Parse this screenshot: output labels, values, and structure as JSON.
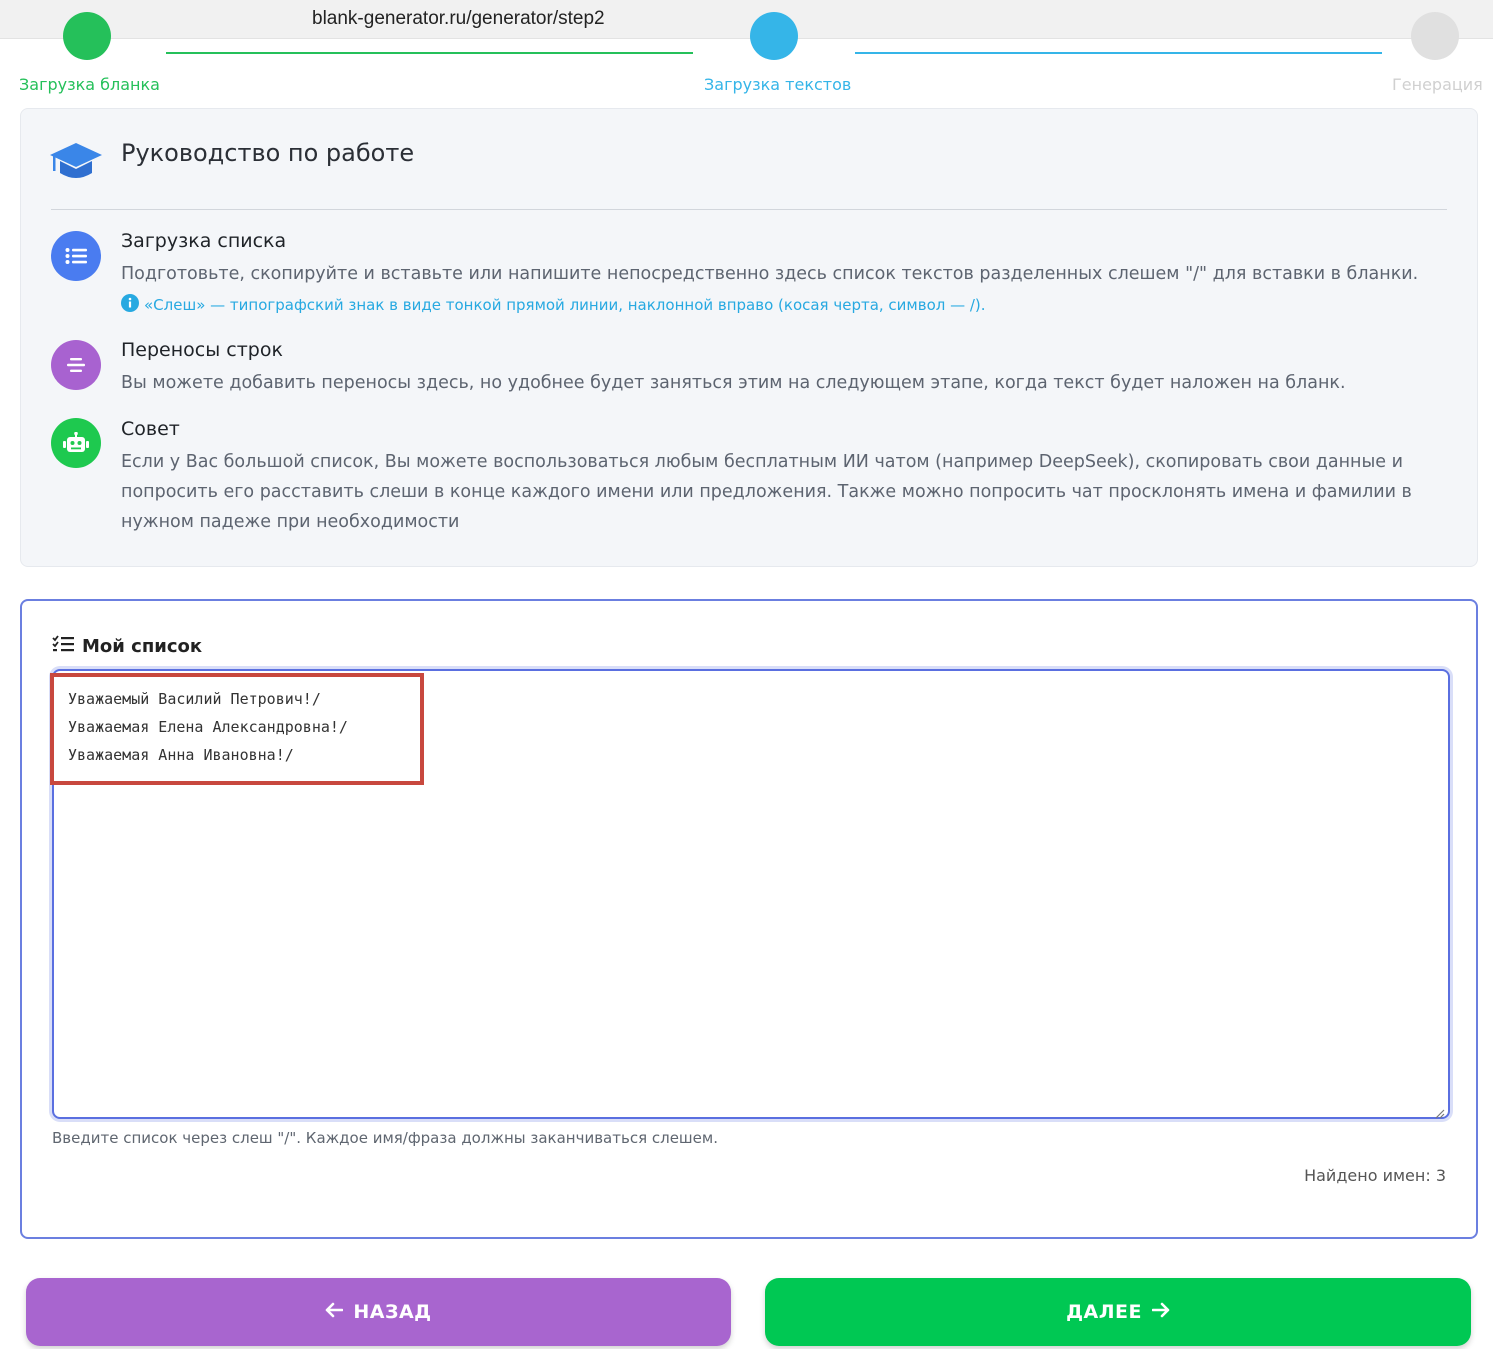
{
  "browser": {
    "url": "blank-generator.ru/generator/step2"
  },
  "stepper": {
    "steps": [
      {
        "label": "Загрузка бланка",
        "state": "done",
        "color": "#25c05a"
      },
      {
        "label": "Загрузка текстов",
        "state": "active",
        "color": "#35b5e8"
      },
      {
        "label": "Генерация",
        "state": "pending",
        "color": "#c8c8c8"
      }
    ]
  },
  "guide": {
    "title": "Руководство по работе",
    "items": [
      {
        "icon": "list-icon",
        "color": "#4a7cf0",
        "title": "Загрузка списка",
        "text": "Подготовьте, скопируйте и вставьте или напишите непосредственно здесь список текстов разделенных слешем \"/\" для вставки в бланки.",
        "note": "«Слеш» — типографский знак в виде тонкой прямой линии, наклонной вправо (косая черта, символ — /)."
      },
      {
        "icon": "align-center-icon",
        "color": "#a862d0",
        "title": "Переносы строк",
        "text": "Вы можете добавить переносы здесь, но удобнее будет заняться этим на следующем этапе, когда текст будет наложен на бланк."
      },
      {
        "icon": "robot-icon",
        "color": "#1ec94f",
        "title": "Совет",
        "text": "Если у Вас большой список, Вы можете воспользоваться любым бесплатным ИИ чатом (например DeepSeek), скопировать свои данные и попросить его расставить слеши в конце каждого имени или предложения. Также можно попросить чат просклонять имена и фамилии в нужном падеже при необходимости"
      }
    ]
  },
  "list": {
    "title": "Мой список",
    "lines": [
      "Уважаемый Василий Петрович!/",
      "Уважаемая Елена Александровна!/",
      "Уважаемая Анна Ивановна!/"
    ],
    "hint": "Введите список через слеш \"/\". Каждое имя/фраза должны заканчиваться слешем.",
    "found_label": "Найдено имен: 3"
  },
  "buttons": {
    "back": {
      "label": "НАЗАД",
      "color": "#a865cf"
    },
    "next": {
      "label": "ДАЛЕЕ",
      "color": "#00c853"
    }
  }
}
